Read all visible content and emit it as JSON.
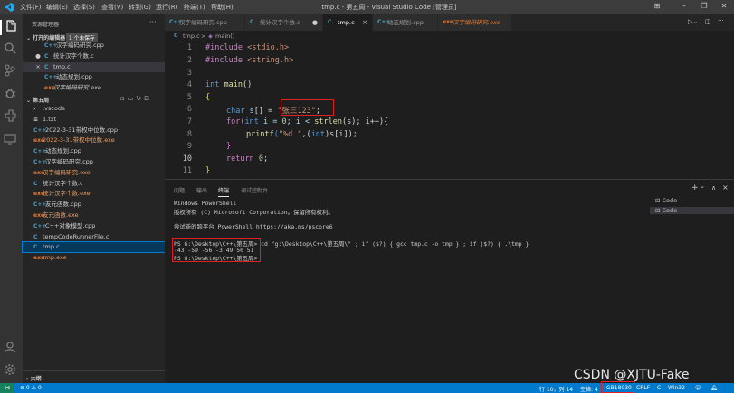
{
  "menu": [
    "文件(F)",
    "编辑(E)",
    "选择(S)",
    "查看(V)",
    "转到(G)",
    "运行(R)",
    "终端(T)",
    "帮助(H)"
  ],
  "window_title": "tmp.c - 第五周 - Visual Studio Code [管理员]",
  "sidebar": {
    "title": "资源管理器",
    "more": "···",
    "open_editors_label": "打开的编辑器",
    "unsaved_badge": "1 个未保存",
    "open_editors": [
      {
        "icon": "C++",
        "name": "汉字编码研究.cpp",
        "marker": ""
      },
      {
        "icon": "C",
        "name": "统计汉字个数.c",
        "marker": "●"
      },
      {
        "icon": "C",
        "name": "tmp.c",
        "marker": "×"
      },
      {
        "icon": "C++",
        "name": "动态规划.cpp",
        "marker": ""
      },
      {
        "icon": "exe",
        "name": "汉字编码研究.exe",
        "marker": ""
      }
    ],
    "folder_label": "第五周",
    "files": [
      {
        "icon": "›",
        "name": ".vscode"
      },
      {
        "icon": "≡",
        "name": "1.txt"
      },
      {
        "icon": "C++",
        "name": "2022-3-31带权中位数.cpp"
      },
      {
        "icon": "exe",
        "name": "2022-3-31带权中位数.exe"
      },
      {
        "icon": "C++",
        "name": "动态规划.cpp"
      },
      {
        "icon": "C++",
        "name": "汉字编码研究.cpp"
      },
      {
        "icon": "exe",
        "name": "汉字编码研究.exe"
      },
      {
        "icon": "C",
        "name": "统计汉字个数.c"
      },
      {
        "icon": "exe",
        "name": "统计汉字个数.exe"
      },
      {
        "icon": "C++",
        "name": "友元函数.cpp"
      },
      {
        "icon": "exe",
        "name": "友元函数.exe"
      },
      {
        "icon": "C++",
        "name": "C++对象模型.cpp"
      },
      {
        "icon": "C",
        "name": "tempCodeRunnerFile.c"
      },
      {
        "icon": "C",
        "name": "tmp.c"
      },
      {
        "icon": "exe",
        "name": "tmp.exe"
      }
    ],
    "outline_label": "大纲"
  },
  "tabs": [
    {
      "icon": "C++",
      "label": "汉字编码研究.cpp",
      "close": ""
    },
    {
      "icon": "C",
      "label": "统计汉字个数.c",
      "close": "●"
    },
    {
      "icon": "C",
      "label": "tmp.c",
      "close": "×"
    },
    {
      "icon": "C++",
      "label": "动态规划.cpp",
      "close": ""
    },
    {
      "icon": "exe",
      "label": "汉字编码研究.exe",
      "close": ""
    }
  ],
  "breadcrumb": {
    "file": "tmp.c",
    "sep": ">",
    "symbol": "main()"
  },
  "editor": {
    "line_numbers": [
      "1",
      "2",
      "3",
      "4",
      "5",
      "6",
      "7",
      "8",
      "9",
      "10",
      "11"
    ],
    "line1": {
      "kw": "#include",
      "inc": " <stdio.h>"
    },
    "line2": {
      "kw": "#include",
      "inc": " <string.h>"
    },
    "line4": {
      "ty": "int",
      "fn": " main",
      "punc": "()"
    },
    "line5": "{",
    "line6": {
      "ty": "char",
      "id": " s",
      "punc": "[] = ",
      "str": "\"张三123\"",
      "end": ";"
    },
    "line7": {
      "kw": "for",
      "a": "(",
      "ty": "int",
      "b": " i = ",
      "n0": "0",
      "c": "; i < ",
      "fn": "strlen",
      "d": "(s); i++){"
    },
    "line8": {
      "fn": "printf",
      "a": "(",
      "str": "\"%d \"",
      "b": ",(",
      "ty": "int",
      "c": ")s[i]);"
    },
    "line9": "}",
    "line10": {
      "kw": "return",
      "n": " 0",
      "end": ";"
    },
    "line11": "}"
  },
  "panel": {
    "tabs": [
      "问题",
      "输出",
      "终端",
      "调试控制台"
    ],
    "active_tab": "终端",
    "terminal_lines": [
      "Windows PowerShell",
      "版权所有 (C) Microsoft Corporation。保留所有权利。",
      "",
      "尝试新的跨平台 PowerShell https://aka.ms/pscore6",
      "",
      "PS G:\\Desktop\\C++\\第五周> cd \"g:\\Desktop\\C++\\第五周\\\" ; if ($?) { gcc tmp.c -o tmp } ; if ($?) { .\\tmp }",
      "-43 -59 -56 -3 49 50 51",
      "PS G:\\Desktop\\C++\\第五周>"
    ],
    "terminal_list": [
      "Code",
      "Code"
    ],
    "actions": [
      "+",
      "⌄",
      "∧",
      "×"
    ]
  },
  "statusbar": {
    "remote": "⋈",
    "problems": "⊗ 0 ⚠ 0",
    "position": "行 10，列 14",
    "spaces": "空格: 4",
    "encoding": "GB18030",
    "eol": "CRLF",
    "language": "C",
    "platform": "Win32"
  },
  "watermark": "CSDN @XJTU-Fake",
  "colors": {
    "accent": "#007acc",
    "highlight_box": "#e02020"
  }
}
